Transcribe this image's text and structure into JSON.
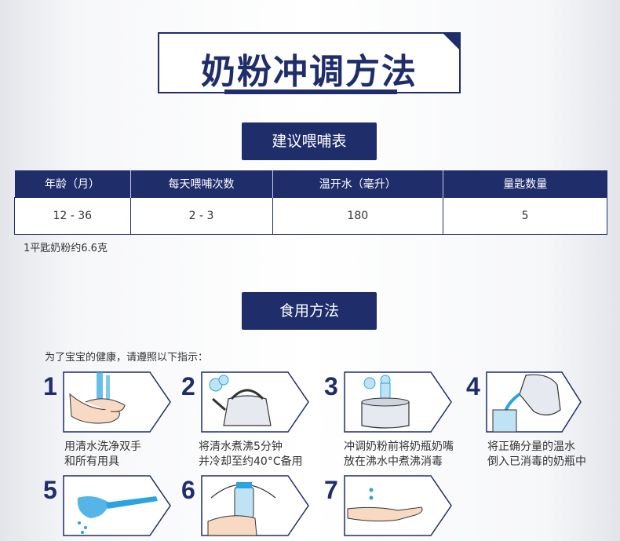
{
  "title": "奶粉冲调方法",
  "feeding_section": {
    "label": "建议喂哺表"
  },
  "feeding_table": {
    "headers": [
      "年龄（月）",
      "每天喂哺次数",
      "温开水（毫升）",
      "量匙数量"
    ],
    "row": [
      "12 - 36",
      "2 - 3",
      "180",
      "5"
    ]
  },
  "note": "1平匙奶粉约6.6克",
  "usage_section": {
    "label": "食用方法"
  },
  "intro": "为了宝宝的健康，请遵照以下指示：",
  "steps": [
    {
      "num": "1",
      "icon": "hand-wash-icon",
      "line1": "用清水洗净双手",
      "line2": "和所有用具"
    },
    {
      "num": "2",
      "icon": "kettle-icon",
      "line1": "将清水煮沸5分钟",
      "line2": "并冷却至约40°C备用"
    },
    {
      "num": "3",
      "icon": "pot-boil-icon",
      "line1": "冲调奶粉前将奶瓶奶嘴",
      "line2": "放在沸水中煮沸消毒"
    },
    {
      "num": "4",
      "icon": "pour-water-icon",
      "line1": "将正确分量的温水",
      "line2": "倒入已消毒的奶瓶中"
    },
    {
      "num": "5",
      "icon": "scoop-powder-icon",
      "line1": "",
      "line2": ""
    },
    {
      "num": "6",
      "icon": "shake-bottle-icon",
      "line1": "",
      "line2": ""
    },
    {
      "num": "7",
      "icon": "wrist-test-icon",
      "line1": "",
      "line2": ""
    }
  ],
  "colors": {
    "navy": "#1f2d6b",
    "water": "#2aa3e0"
  }
}
